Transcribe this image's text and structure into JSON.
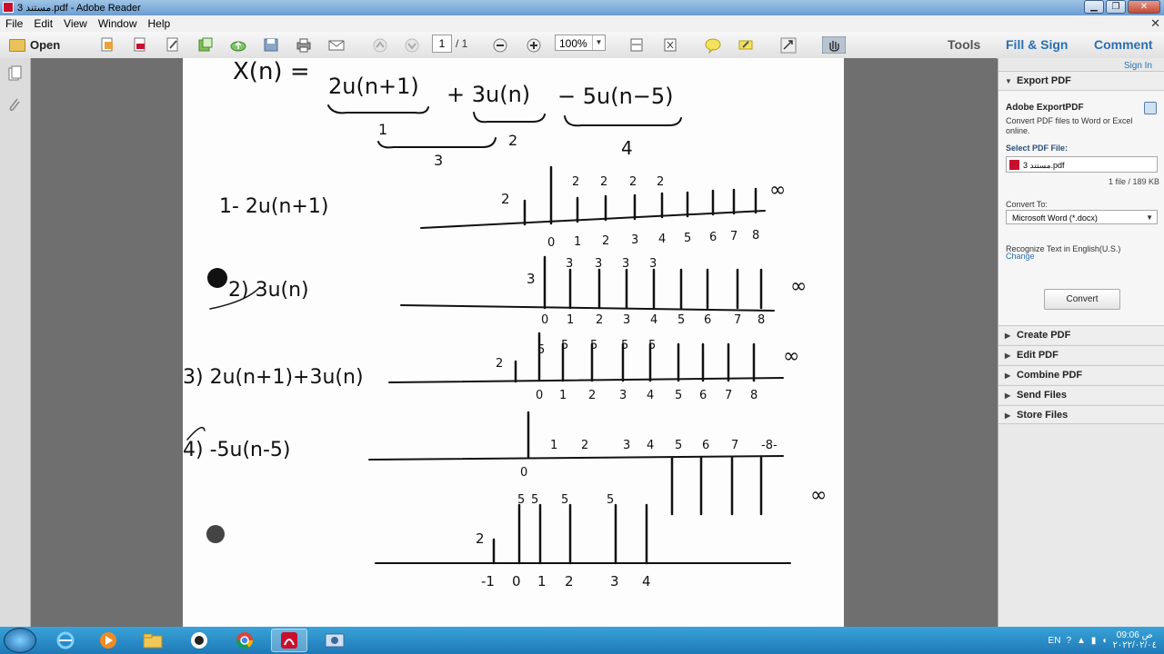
{
  "window": {
    "title": "مستند 3.pdf - Adobe Reader",
    "controls": [
      "▁",
      "❐",
      "✕"
    ]
  },
  "menu": {
    "items": [
      "File",
      "Edit",
      "View",
      "Window",
      "Help"
    ],
    "close_glyph": "✕"
  },
  "toolbar": {
    "open_label": "Open",
    "page_current": "1",
    "page_total": "/ 1",
    "zoom": "100%",
    "right_tabs": [
      "Tools",
      "Fill & Sign",
      "Comment"
    ]
  },
  "right_panel": {
    "sign_in": "Sign In",
    "export": {
      "header": "Export PDF",
      "title": "Adobe ExportPDF",
      "description": "Convert PDF files to Word or Excel online.",
      "select_label": "Select PDF File:",
      "file_name": "مستند 3.pdf",
      "file_count": "1 file / 189 KB",
      "convert_to_label": "Convert To:",
      "convert_to_value": "Microsoft Word (*.docx)",
      "recognize_text": "Recognize Text in English(U.S.)",
      "change_link": "Change",
      "convert_button": "Convert"
    },
    "sections": [
      "Create PDF",
      "Edit PDF",
      "Combine PDF",
      "Send Files",
      "Store Files"
    ]
  },
  "document": {
    "equation_parts": [
      "X(n) =",
      "2u(n+1)",
      "+ 3u(n)",
      "− 5u(n−5)"
    ],
    "brace_labels": [
      "1",
      "2",
      "3",
      "4"
    ],
    "rows": [
      {
        "label": "1- 2u(n+1)",
        "amplitudes": [
          "2",
          "2",
          "2",
          "2",
          "2"
        ],
        "ticks": [
          "0",
          "1",
          "2",
          "3",
          "4",
          "5",
          "6",
          "7",
          "8"
        ],
        "infinity": "∞"
      },
      {
        "label": "2) 3u(n)",
        "amplitudes": [
          "3",
          "3",
          "3",
          "3",
          "3"
        ],
        "ticks": [
          "0",
          "1",
          "2",
          "3",
          "4",
          "5",
          "6",
          "7",
          "8"
        ],
        "infinity": "∞"
      },
      {
        "label": "3) 2u(n+1)+3u(n)",
        "amplitudes": [
          "2",
          "5",
          "5",
          "5",
          "5",
          "5"
        ],
        "ticks": [
          "0",
          "1",
          "2",
          "3",
          "4",
          "5",
          "6",
          "7",
          "8"
        ],
        "infinity": "∞"
      },
      {
        "label": "4) -5u(n-5)",
        "ticks": [
          "0",
          "1",
          "2",
          "3",
          "4",
          "5",
          "6",
          "7",
          "-8-"
        ],
        "infinity": "∞"
      },
      {
        "amplitudes": [
          "2",
          "5",
          "5",
          "5",
          "5"
        ],
        "ticks": [
          "-1",
          "0",
          "1",
          "2",
          "3",
          "4"
        ]
      }
    ]
  },
  "taskbar": {
    "language": "EN",
    "time": "09:06 ص",
    "date": "٢٠٢٢/٠٢/٠٤"
  }
}
